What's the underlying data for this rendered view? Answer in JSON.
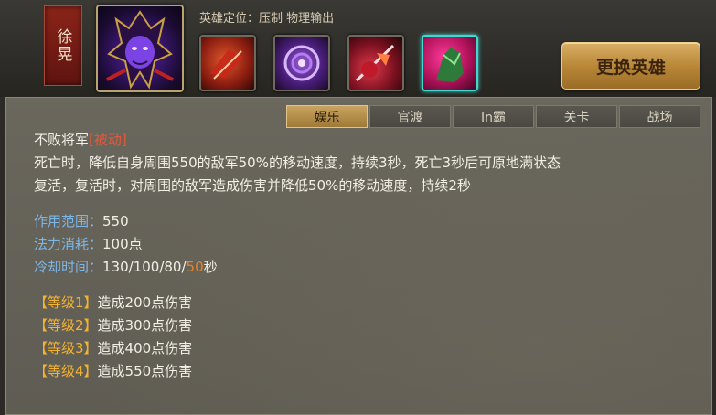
{
  "header": {
    "hero_name": "徐晃",
    "role_label": "英雄定位：压制  物理输出",
    "swap_button": "更换英雄",
    "skills": [
      {
        "icon": "skill-1-icon",
        "color": "#a8301f"
      },
      {
        "icon": "skill-2-icon",
        "color": "#6a34a8"
      },
      {
        "icon": "skill-3-icon",
        "color": "#b02a2a"
      },
      {
        "icon": "skill-4-icon",
        "color": "#c0206a",
        "selected": true
      }
    ]
  },
  "tabs": [
    {
      "label": "娱乐",
      "active": true
    },
    {
      "label": "官渡",
      "active": false
    },
    {
      "label": "In霸",
      "active": false
    },
    {
      "label": "关卡",
      "active": false
    },
    {
      "label": "战场",
      "active": false
    }
  ],
  "skill_detail": {
    "name": "不败将军",
    "tag": "[被动]",
    "description_1": "死亡时，降低自身周围550的敌军50%的移动速度，持续3秒，死亡3秒后可原地满状态",
    "description_2": "复活，复活时，对周围的敌军造成伤害并降低50%的移动速度，持续2秒",
    "range_label": "作用范围：",
    "range_value": "550",
    "cost_label": "法力消耗：",
    "cost_value": "100点",
    "cooldown_label": "冷却时间：",
    "cooldown_prefix": "130/100/80/",
    "cooldown_highlight": "50",
    "cooldown_unit": "秒",
    "levels": [
      {
        "label": "【等级1】",
        "text": "造成200点伤害"
      },
      {
        "label": "【等级2】",
        "text": "造成300点伤害"
      },
      {
        "label": "【等级3】",
        "text": "造成400点伤害"
      },
      {
        "label": "【等级4】",
        "text": "造成550点伤害"
      }
    ]
  }
}
